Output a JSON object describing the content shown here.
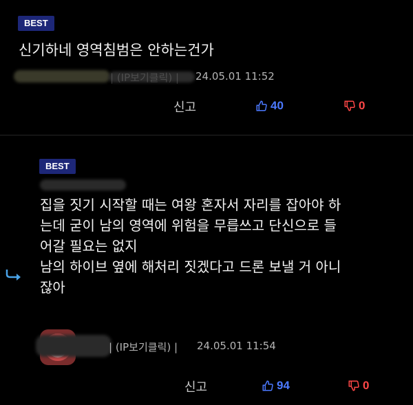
{
  "comments": [
    {
      "badge": "BEST",
      "text": "신기하네 영역침범은 안하는건가",
      "meta_ip": "| (IP보기클릭) |",
      "meta_date": "24.05.01 11:52",
      "report_label": "신고",
      "likes": "40",
      "dislikes": "0"
    },
    {
      "badge": "BEST",
      "lines": [
        "집을 짓기 시작할 때는 여왕 혼자서 자리를 잡아야 하",
        "는데 굳이 남의 영역에 위험을 무릅쓰고 단신으로 들",
        "어갈 필요는 없지",
        "남의 하이브 옆에 해처리 짓겠다고 드론 보낼 거 아니",
        "잖아"
      ],
      "meta_ip": "| (IP보기클릭) |",
      "meta_date": "24.05.01 11:54",
      "report_label": "신고",
      "likes": "94",
      "dislikes": "0"
    }
  ],
  "icons": {
    "like": "thumbs-up-icon",
    "dislike": "thumbs-down-icon",
    "reply": "reply-arrow-icon"
  },
  "colors": {
    "background": "#000000",
    "badge": "#1d2778",
    "like": "#4b79ff",
    "dislike": "#ff4747",
    "reply_arrow": "#4aa3e8"
  }
}
